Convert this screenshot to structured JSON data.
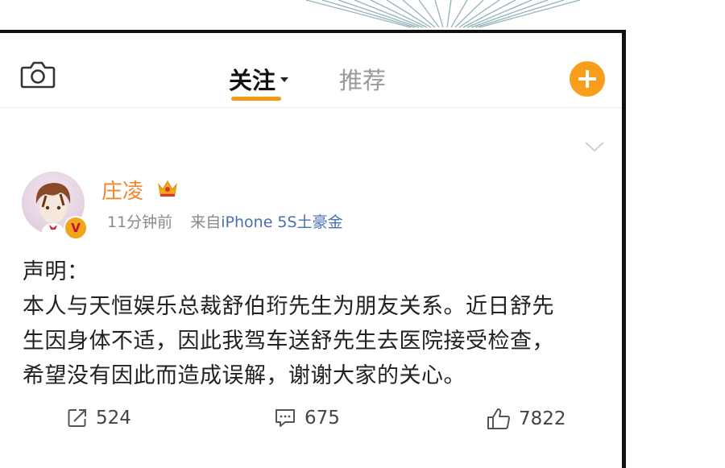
{
  "topbar": {
    "tab_follow": "关注",
    "tab_recommend": "推荐"
  },
  "post": {
    "username": "庄凌",
    "time_ago": "11分钟前",
    "source_prefix": "来自",
    "source": "iPhone 5S土豪金",
    "verified_mark": "V",
    "content": [
      "声明：",
      "本人与天恒娱乐总裁舒伯珩先生为朋友关系。近日舒先",
      "生因身体不适，因此我驾车送舒先生去医院接受检查，",
      "希望没有因此而造成误解，谢谢大家的关心。"
    ],
    "actions": {
      "repost_count": "524",
      "comment_count": "675",
      "like_count": "7822"
    }
  },
  "colors": {
    "accent_orange": "#f29b12",
    "username": "#f0862a",
    "source_link": "#4a6fb0"
  },
  "icons": [
    "camera-icon",
    "caret-down-icon",
    "add-icon",
    "chevron-down-icon",
    "crown-icon",
    "verified-icon",
    "repost-icon",
    "comment-icon",
    "like-icon"
  ]
}
